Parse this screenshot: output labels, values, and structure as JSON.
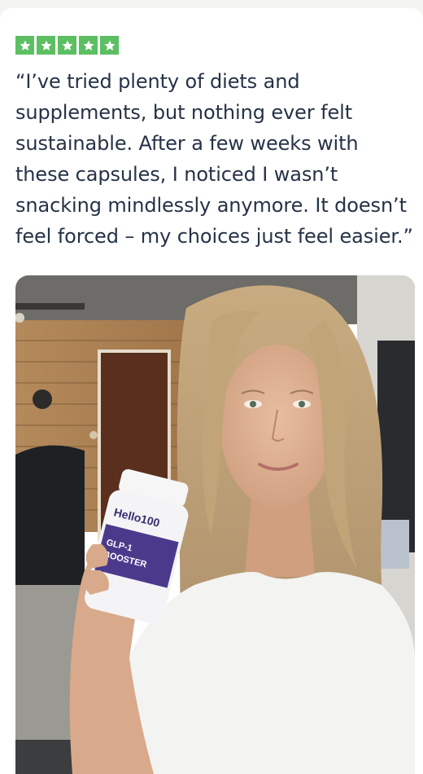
{
  "review": {
    "rating": 5,
    "rating_max": 5,
    "star_color": "#5cbf62",
    "quote": "“I’ve tried plenty of diets and supplements, but nothing ever felt sustainable. After a few weeks with these capsules, I noticed I wasn’t snacking mindlessly anymore. It doesn’t feel forced – my choices just feel easier.”",
    "text_color": "#253247"
  },
  "photo": {
    "icon": "customer-photo",
    "bottle": {
      "brand": "Hello100",
      "product_line1": "GLP-1",
      "product_line2": "BOOSTER",
      "accent_color": "#4b3a8c"
    }
  }
}
